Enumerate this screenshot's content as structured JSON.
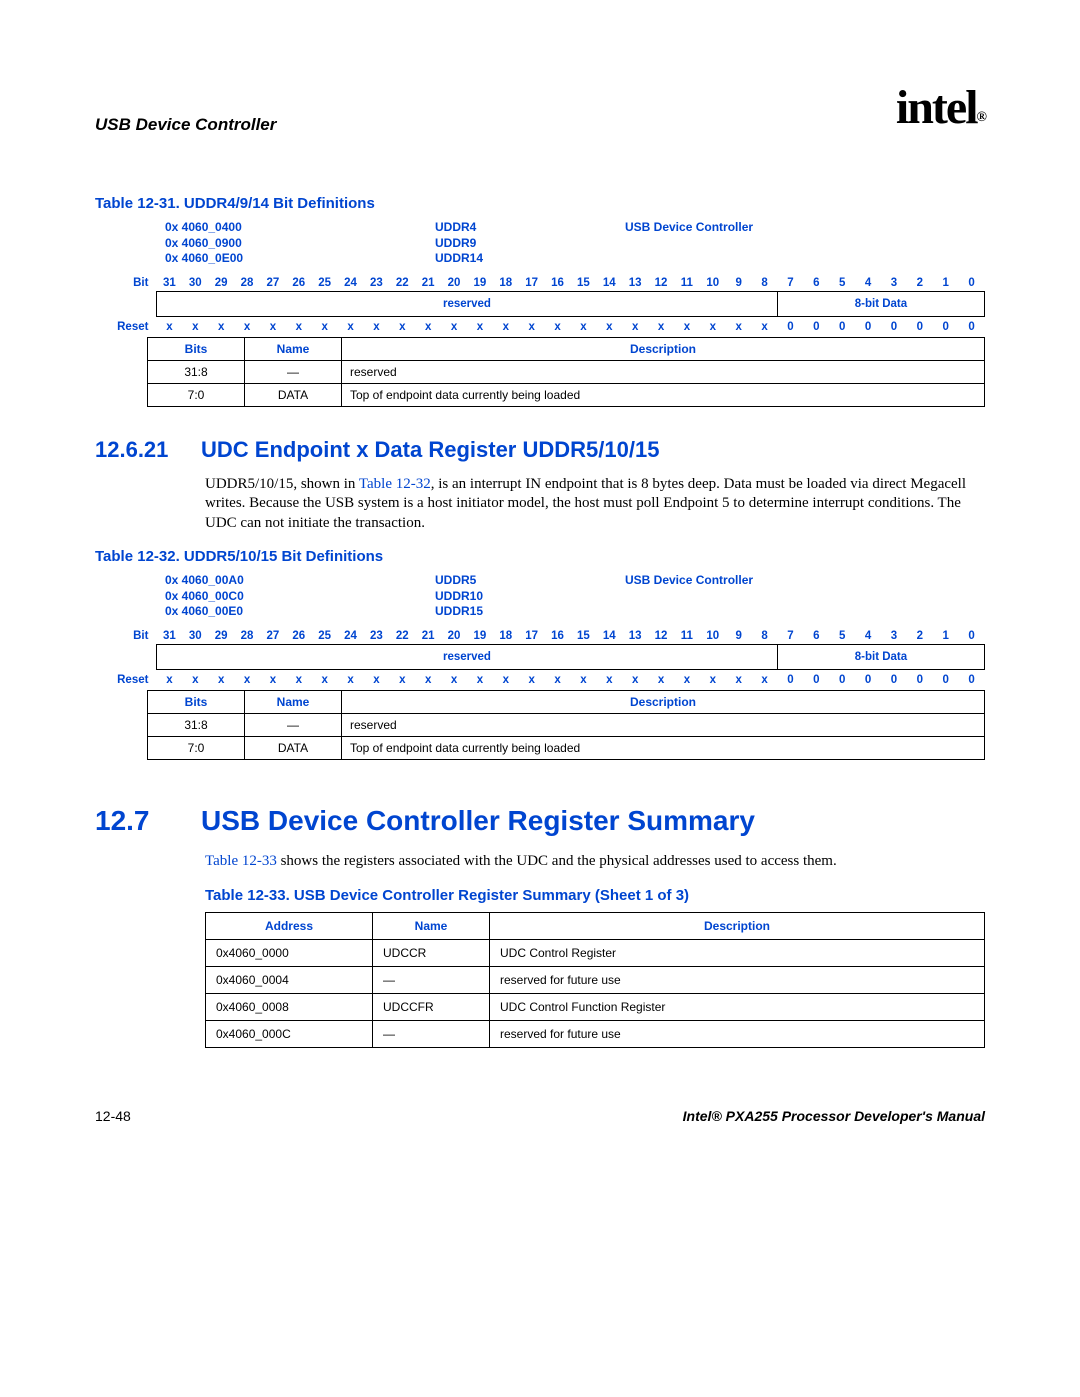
{
  "header": {
    "title": "USB Device Controller",
    "logo": "intel",
    "logo_sub": "®"
  },
  "table31": {
    "title": "Table 12-31. UDDR4/9/14 Bit Definitions",
    "addresses": "0x 4060_0400\n0x 4060_0900\n0x 4060_0E00",
    "names": "UDDR4\nUDDR9\nUDDR14",
    "controller": "USB Device Controller",
    "bit_label": "Bit",
    "reset_label": "Reset",
    "bits": [
      "31",
      "30",
      "29",
      "28",
      "27",
      "26",
      "25",
      "24",
      "23",
      "22",
      "21",
      "20",
      "19",
      "18",
      "17",
      "16",
      "15",
      "14",
      "13",
      "12",
      "11",
      "10",
      "9",
      "8",
      "7",
      "6",
      "5",
      "4",
      "3",
      "2",
      "1",
      "0"
    ],
    "field_reserved": "reserved",
    "field_data": "8-bit Data",
    "reset_values": [
      "x",
      "x",
      "x",
      "x",
      "x",
      "x",
      "x",
      "x",
      "x",
      "x",
      "x",
      "x",
      "x",
      "x",
      "x",
      "x",
      "x",
      "x",
      "x",
      "x",
      "x",
      "x",
      "x",
      "x",
      "0",
      "0",
      "0",
      "0",
      "0",
      "0",
      "0",
      "0"
    ],
    "headers": {
      "bits": "Bits",
      "name": "Name",
      "desc": "Description"
    },
    "rows": [
      {
        "bits": "31:8",
        "name": "—",
        "desc": "reserved"
      },
      {
        "bits": "7:0",
        "name": "DATA",
        "desc": "Top of endpoint data currently being loaded"
      }
    ]
  },
  "section21": {
    "num": "12.6.21",
    "title": "UDC Endpoint x Data Register UDDR5/10/15",
    "text_before": "UDDR5/10/15, shown in ",
    "text_ref": "Table 12-32",
    "text_after": ", is an interrupt IN endpoint that is 8 bytes deep. Data must be loaded via direct Megacell writes. Because the USB system is a host initiator model, the host must poll Endpoint 5 to determine interrupt conditions. The UDC can not initiate the transaction."
  },
  "table32": {
    "title": "Table 12-32. UDDR5/10/15 Bit Definitions",
    "addresses": "0x 4060_00A0\n0x 4060_00C0\n0x 4060_00E0",
    "names": "UDDR5\nUDDR10\nUDDR15",
    "controller": "USB Device Controller",
    "bit_label": "Bit",
    "reset_label": "Reset",
    "bits": [
      "31",
      "30",
      "29",
      "28",
      "27",
      "26",
      "25",
      "24",
      "23",
      "22",
      "21",
      "20",
      "19",
      "18",
      "17",
      "16",
      "15",
      "14",
      "13",
      "12",
      "11",
      "10",
      "9",
      "8",
      "7",
      "6",
      "5",
      "4",
      "3",
      "2",
      "1",
      "0"
    ],
    "field_reserved": "reserved",
    "field_data": "8-bit Data",
    "reset_values": [
      "x",
      "x",
      "x",
      "x",
      "x",
      "x",
      "x",
      "x",
      "x",
      "x",
      "x",
      "x",
      "x",
      "x",
      "x",
      "x",
      "x",
      "x",
      "x",
      "x",
      "x",
      "x",
      "x",
      "x",
      "0",
      "0",
      "0",
      "0",
      "0",
      "0",
      "0",
      "0"
    ],
    "headers": {
      "bits": "Bits",
      "name": "Name",
      "desc": "Description"
    },
    "rows": [
      {
        "bits": "31:8",
        "name": "—",
        "desc": "reserved"
      },
      {
        "bits": "7:0",
        "name": "DATA",
        "desc": "Top of endpoint data currently being loaded"
      }
    ]
  },
  "section7": {
    "num": "12.7",
    "title": "USB Device Controller Register Summary",
    "text_ref": "Table 12-33",
    "text_after": " shows the registers associated with the UDC and the physical addresses used to access them."
  },
  "table33": {
    "title": "Table 12-33. USB Device Controller Register Summary (Sheet 1 of 3)",
    "headers": {
      "addr": "Address",
      "name": "Name",
      "desc": "Description"
    },
    "rows": [
      {
        "addr": "0x4060_0000",
        "name": "UDCCR",
        "desc": "UDC Control Register"
      },
      {
        "addr": "0x4060_0004",
        "name": "—",
        "desc": "reserved for future use"
      },
      {
        "addr": "0x4060_0008",
        "name": "UDCCFR",
        "desc": "UDC Control Function Register"
      },
      {
        "addr": "0x4060_000C",
        "name": "—",
        "desc": "reserved for future use"
      }
    ]
  },
  "footer": {
    "page": "12-48",
    "manual": "Intel® PXA255 Processor Developer's Manual"
  }
}
